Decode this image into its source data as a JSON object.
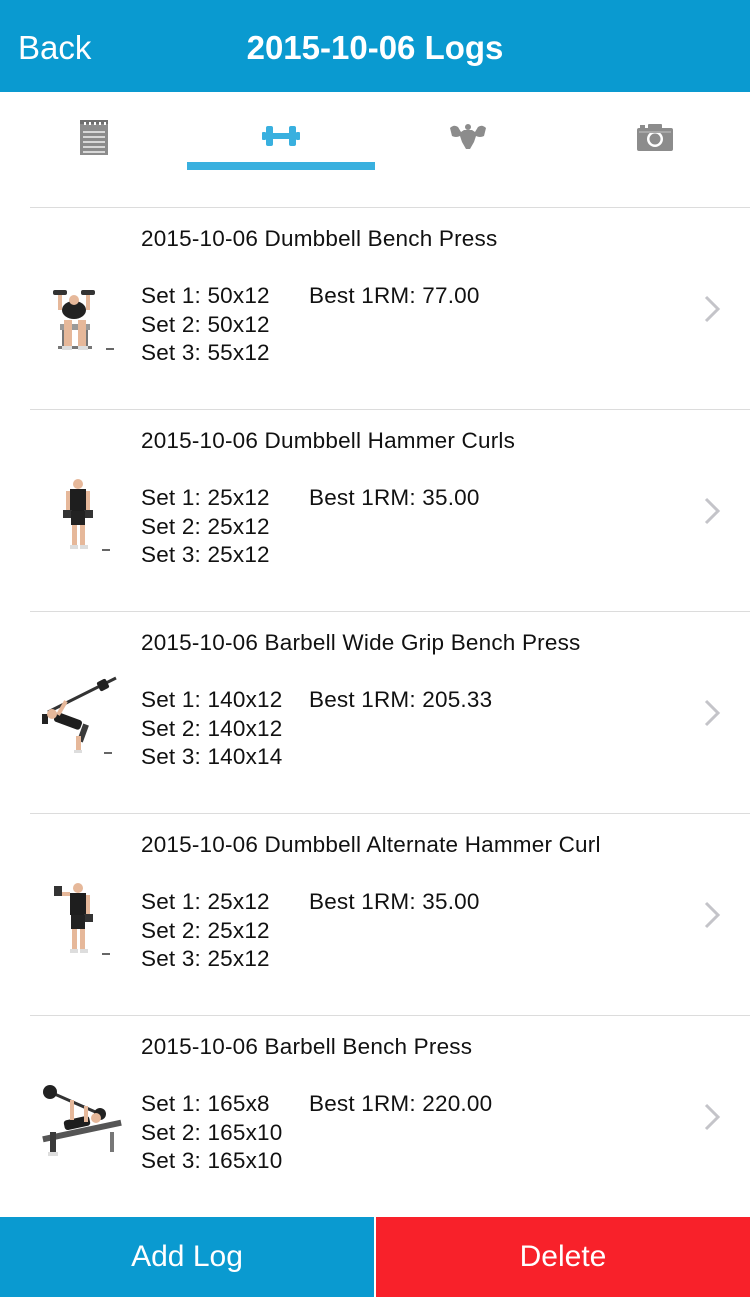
{
  "navbar": {
    "back_label": "Back",
    "title": "2015-10-06 Logs"
  },
  "tabs": [
    {
      "icon": "notepad-icon",
      "active": false
    },
    {
      "icon": "dumbbell-icon",
      "active": true
    },
    {
      "icon": "muscle-icon",
      "active": false
    },
    {
      "icon": "camera-icon",
      "active": false
    }
  ],
  "colors": {
    "accent": "#0a9ad0",
    "tab_indicator": "#39b0df",
    "delete": "#f8212a",
    "inactive_icon": "#8c8c8c"
  },
  "logs": [
    {
      "title": "2015-10-06 Dumbbell Bench Press",
      "sets": [
        "Set 1: 50x12",
        "Set 2: 50x12",
        "Set 3: 55x12"
      ],
      "best": "Best 1RM: 77.00",
      "thumbnail": "bench-press-figure"
    },
    {
      "title": "2015-10-06 Dumbbell Hammer Curls",
      "sets": [
        "Set 1: 25x12",
        "Set 2: 25x12",
        "Set 3: 25x12"
      ],
      "best": "Best 1RM: 35.00",
      "thumbnail": "standing-curl-figure"
    },
    {
      "title": "2015-10-06 Barbell Wide Grip Bench Press",
      "sets": [
        "Set 1: 140x12",
        "Set 2: 140x12",
        "Set 3: 140x14"
      ],
      "best": "Best 1RM: 205.33",
      "thumbnail": "barbell-bench-figure"
    },
    {
      "title": "2015-10-06 Dumbbell Alternate Hammer Curl",
      "sets": [
        "Set 1: 25x12",
        "Set 2: 25x12",
        "Set 3: 25x12"
      ],
      "best": "Best 1RM: 35.00",
      "thumbnail": "standing-curl-figure"
    },
    {
      "title": "2015-10-06 Barbell Bench Press",
      "sets": [
        "Set 1: 165x8",
        "Set 2: 165x10",
        "Set 3: 165x10"
      ],
      "best": "Best 1RM: 220.00",
      "thumbnail": "barbell-bench-figure"
    }
  ],
  "footer": {
    "add_label": "Add Log",
    "delete_label": "Delete"
  }
}
